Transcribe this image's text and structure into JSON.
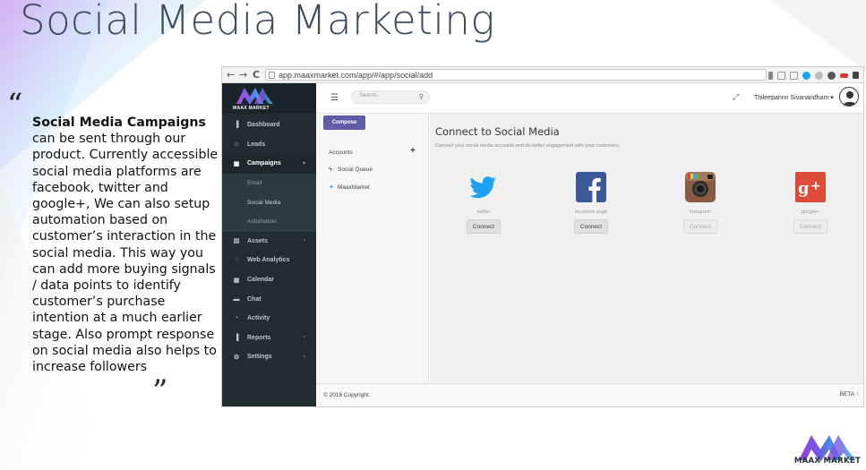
{
  "slide": {
    "title": "Social Media Marketing",
    "quote_open": "“",
    "quote_close": "”",
    "body_bold": "Social Media Campaigns",
    "body_text": " can be sent through our product. Currently accessible social media platforms are facebook, twitter and google+, We can also setup automation based on customer’s interaction in the social media. This way you can add more buying signals / data points to identify customer’s purchase intention at a much earlier stage. Also prompt response on social media also helps to increase followers",
    "logo_text": "MAAX MARKET"
  },
  "browser": {
    "url": "app.maaxmarket.com/app/#/app/social/add",
    "back_label": "←",
    "forward_label": "→",
    "reload_label": "C"
  },
  "app": {
    "brand_text": "MAAX MARKET",
    "search_placeholder": "Search...",
    "user_name": "Thileepannn Sivanandham ▾",
    "sidebar": [
      {
        "label": "Dashboard",
        "icon": "bar-chart-icon",
        "glyph": "▐"
      },
      {
        "label": "Leads",
        "icon": "user-icon",
        "glyph": "☺"
      },
      {
        "label": "Campaigns",
        "icon": "grid-icon",
        "glyph": "▦",
        "chevron": "▾"
      },
      {
        "label": "Assets",
        "icon": "briefcase-icon",
        "glyph": "▤",
        "chevron": "›"
      },
      {
        "label": "Web Analytics",
        "icon": "globe-icon",
        "glyph": "◌"
      },
      {
        "label": "Calendar",
        "icon": "calendar-icon",
        "glyph": "▦"
      },
      {
        "label": "Chat",
        "icon": "chat-icon",
        "glyph": "▬"
      },
      {
        "label": "Activity",
        "icon": "clock-icon",
        "glyph": "◔"
      },
      {
        "label": "Reports",
        "icon": "report-icon",
        "glyph": "▐",
        "chevron": "›"
      },
      {
        "label": "Settings",
        "icon": "gear-icon",
        "glyph": "⚙",
        "chevron": "›"
      }
    ],
    "campaign_sub": [
      "Email",
      "Social Media",
      "Automation"
    ],
    "compose_label": "Compose",
    "accounts_title": "Accounts",
    "plus_label": "+",
    "accounts": [
      {
        "label": "Social Queue",
        "glyph": "ϟ"
      },
      {
        "label": "MaaxMarket",
        "glyph": "✦"
      }
    ],
    "connect_title": "Connect to Social Media",
    "connect_subtitle": "Connect your social media accounts and do better engagement with your customers.",
    "networks": [
      {
        "label": "twitter",
        "button": "Connect",
        "enabled": true,
        "color": "#1da1f2"
      },
      {
        "label": "facebook page",
        "button": "Connect",
        "enabled": true,
        "color": "#3b5998"
      },
      {
        "label": "instagram",
        "button": "Connect",
        "enabled": false,
        "color": "#8a5a44"
      },
      {
        "label": "google+",
        "button": "Connect",
        "enabled": false,
        "color": "#dd4b39"
      }
    ],
    "footer_copy": "© 2016 Copyright.",
    "footer_beta": "BETA ↑"
  }
}
